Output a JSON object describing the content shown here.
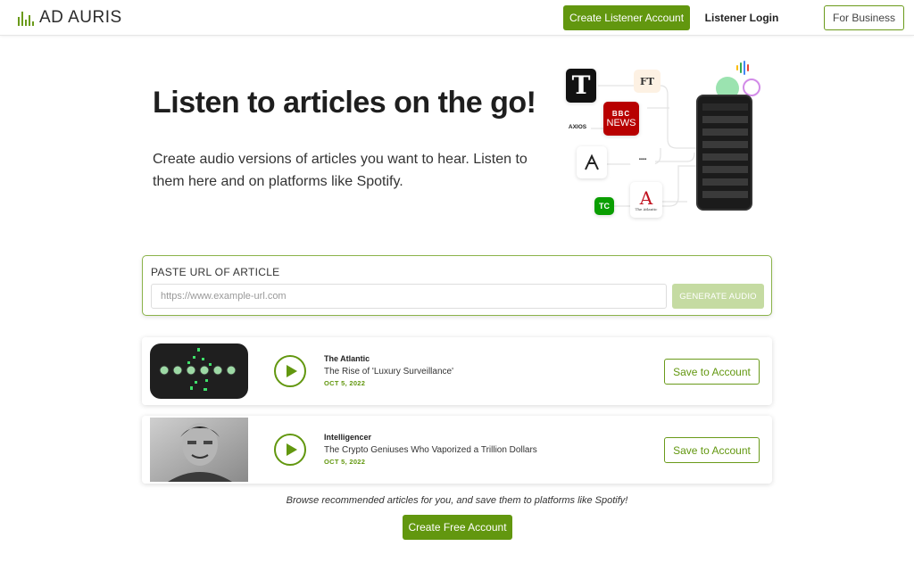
{
  "header": {
    "brand": "AD AURIS",
    "create_account": "Create Listener Account",
    "login": "Listener Login",
    "for_business": "For Business"
  },
  "hero": {
    "title": "Listen to articles on the go!",
    "subtitle": "Create audio versions of articles you want to hear. Listen to them here and on platforms like Spotify."
  },
  "illustration": {
    "logos": [
      "FT",
      "BBC",
      "NEWS",
      "AXIOS",
      "TC",
      "A",
      "The Atlantic"
    ]
  },
  "url_form": {
    "label": "PASTE URL OF ARTICLE",
    "placeholder": "https://www.example-url.com",
    "button": "GENERATE AUDIO"
  },
  "articles": [
    {
      "publication": "The Atlantic",
      "title": "The Rise of 'Luxury Surveillance'",
      "date": "OCT 5, 2022",
      "save": "Save to Account"
    },
    {
      "publication": "Intelligencer",
      "title": "The Crypto Geniuses Who Vaporized a Trillion Dollars",
      "date": "OCT 5, 2022",
      "save": "Save to Account"
    }
  ],
  "footer": {
    "browse": "Browse recommended articles for you, and save them to platforms like Spotify!",
    "create_free": "Create Free Account"
  },
  "colors": {
    "accent": "#62970f",
    "accent_light": "#c5dba2",
    "border_green": "#8bb34a"
  }
}
